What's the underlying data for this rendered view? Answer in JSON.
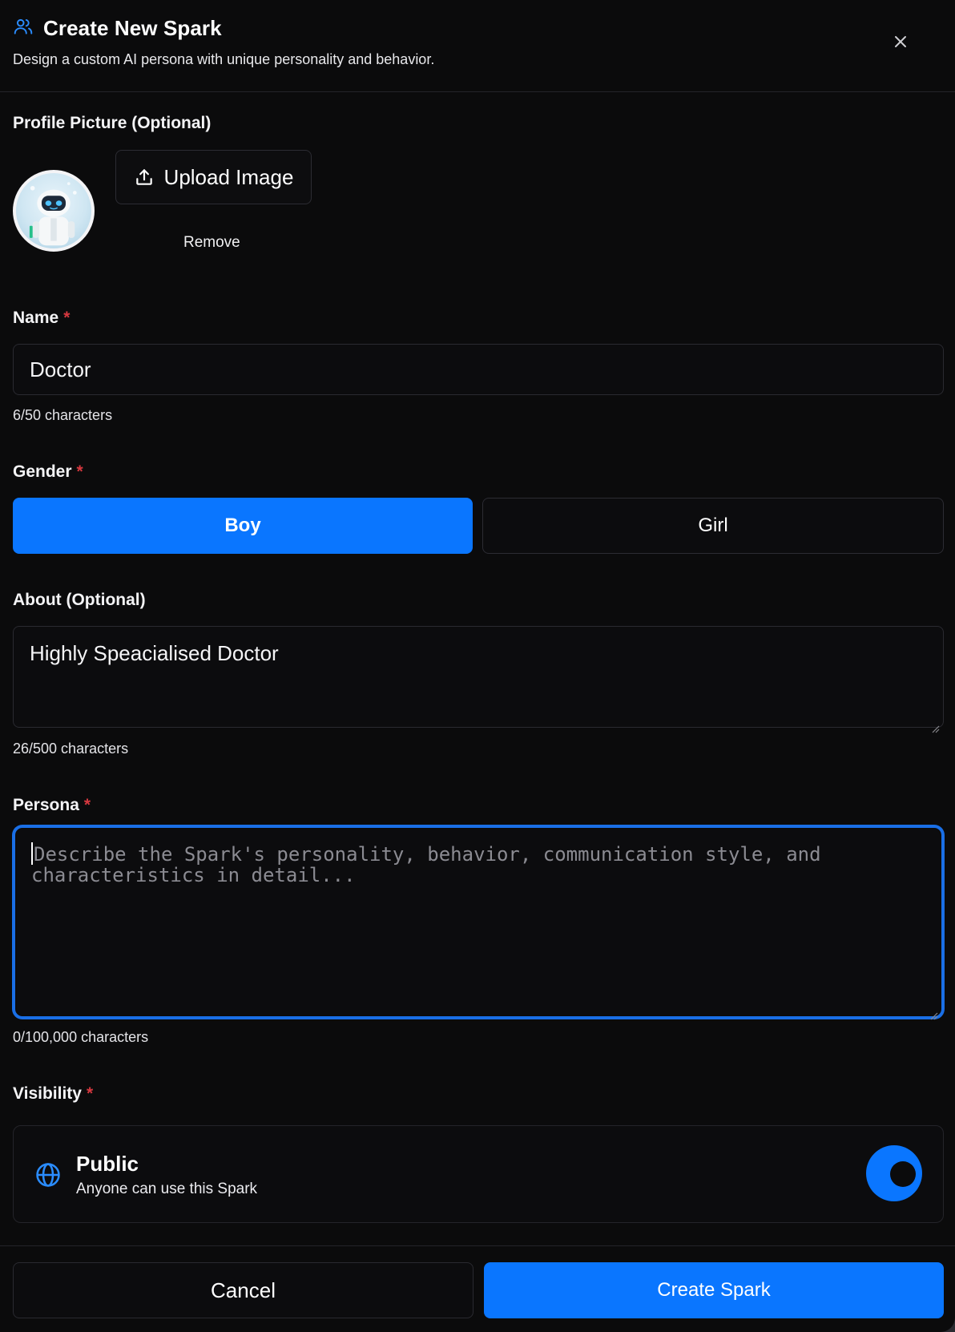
{
  "header": {
    "title": "Create New Spark",
    "subtitle": "Design a custom AI persona with unique personality and behavior.",
    "icon": "users-icon",
    "close_icon": "close-icon"
  },
  "profile_picture": {
    "label": "Profile Picture (Optional)",
    "upload_label": "Upload Image",
    "remove_label": "Remove",
    "upload_icon": "upload-icon"
  },
  "name": {
    "label": "Name",
    "required_mark": "*",
    "value": "Doctor",
    "counter": "6/50 characters"
  },
  "gender": {
    "label": "Gender",
    "required_mark": "*",
    "options": [
      "Boy",
      "Girl"
    ],
    "selected": "Boy"
  },
  "about": {
    "label": "About (Optional)",
    "value": "Highly Speacialised Doctor",
    "counter": "26/500 characters"
  },
  "persona": {
    "label": "Persona",
    "required_mark": "*",
    "placeholder": "Describe the Spark's personality, behavior, communication style, and characteristics in detail...",
    "counter": "0/100,000 characters"
  },
  "visibility": {
    "label": "Visibility",
    "required_mark": "*",
    "option_title": "Public",
    "option_desc": "Anyone can use this Spark",
    "icon": "globe-icon",
    "toggle_on": true
  },
  "footer": {
    "cancel_label": "Cancel",
    "create_label": "Create Spark"
  },
  "colors": {
    "accent": "#0a76ff",
    "background": "#0b0b0c",
    "required": "#d6383f"
  }
}
